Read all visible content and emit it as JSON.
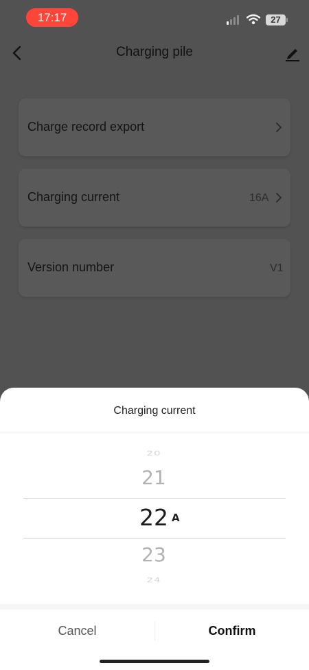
{
  "status_bar": {
    "time": "17:17",
    "battery": "27",
    "icons": [
      "signal-icon",
      "wifi-icon",
      "battery-icon"
    ],
    "time_pill_color": "#ff453a"
  },
  "nav": {
    "title": "Charging pile",
    "icons": [
      "back-arrow-icon",
      "edit-pencil-icon"
    ]
  },
  "settings": {
    "items": [
      {
        "label": "Charge record export",
        "value": "",
        "has_chevron": true
      },
      {
        "label": "Charging current",
        "value": "16A",
        "has_chevron": true
      },
      {
        "label": "Version number",
        "value": "V1",
        "has_chevron": false
      }
    ]
  },
  "picker_sheet": {
    "title": "Charging current",
    "options": [
      "20",
      "21",
      "22",
      "23",
      "24"
    ],
    "selected": "22",
    "unit": "A",
    "cancel_label": "Cancel",
    "confirm_label": "Confirm"
  },
  "colors": {
    "overlay_background": "#525252",
    "card_background": "#595959",
    "sheet_background": "#ffffff"
  }
}
